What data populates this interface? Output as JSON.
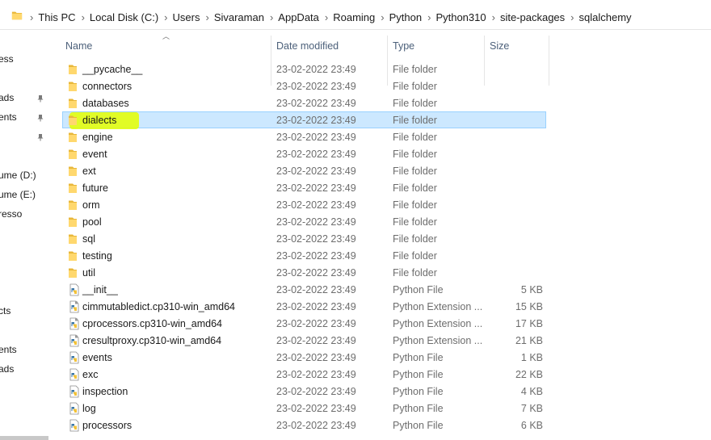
{
  "address": {
    "crumbs": [
      "This PC",
      "Local Disk (C:)",
      "Users",
      "Sivaraman",
      "AppData",
      "Roaming",
      "Python",
      "Python310",
      "site-packages",
      "sqlalchemy"
    ]
  },
  "nav": {
    "items": [
      {
        "label": "ess",
        "pinned": false
      },
      {
        "label": "ads",
        "pinned": true
      },
      {
        "label": "ents",
        "pinned": true
      },
      {
        "label": "",
        "pinned": true
      },
      {
        "label": "ume (D:)",
        "pinned": false
      },
      {
        "label": "ume (E:)",
        "pinned": false
      },
      {
        "label": "resso",
        "pinned": false
      },
      {
        "label": "cts",
        "pinned": false
      },
      {
        "label": "ents",
        "pinned": false
      },
      {
        "label": "ads",
        "pinned": false
      }
    ]
  },
  "columns": {
    "name": "Name",
    "date": "Date modified",
    "type": "Type",
    "size": "Size"
  },
  "files": [
    {
      "name": "__pycache__",
      "date": "23-02-2022 23:49",
      "type": "File folder",
      "size": "",
      "kind": "folder"
    },
    {
      "name": "connectors",
      "date": "23-02-2022 23:49",
      "type": "File folder",
      "size": "",
      "kind": "folder"
    },
    {
      "name": "databases",
      "date": "23-02-2022 23:49",
      "type": "File folder",
      "size": "",
      "kind": "folder"
    },
    {
      "name": "dialects",
      "date": "23-02-2022 23:49",
      "type": "File folder",
      "size": "",
      "kind": "folder",
      "selected": true
    },
    {
      "name": "engine",
      "date": "23-02-2022 23:49",
      "type": "File folder",
      "size": "",
      "kind": "folder"
    },
    {
      "name": "event",
      "date": "23-02-2022 23:49",
      "type": "File folder",
      "size": "",
      "kind": "folder"
    },
    {
      "name": "ext",
      "date": "23-02-2022 23:49",
      "type": "File folder",
      "size": "",
      "kind": "folder"
    },
    {
      "name": "future",
      "date": "23-02-2022 23:49",
      "type": "File folder",
      "size": "",
      "kind": "folder"
    },
    {
      "name": "orm",
      "date": "23-02-2022 23:49",
      "type": "File folder",
      "size": "",
      "kind": "folder"
    },
    {
      "name": "pool",
      "date": "23-02-2022 23:49",
      "type": "File folder",
      "size": "",
      "kind": "folder"
    },
    {
      "name": "sql",
      "date": "23-02-2022 23:49",
      "type": "File folder",
      "size": "",
      "kind": "folder"
    },
    {
      "name": "testing",
      "date": "23-02-2022 23:49",
      "type": "File folder",
      "size": "",
      "kind": "folder"
    },
    {
      "name": "util",
      "date": "23-02-2022 23:49",
      "type": "File folder",
      "size": "",
      "kind": "folder"
    },
    {
      "name": "__init__",
      "date": "23-02-2022 23:49",
      "type": "Python File",
      "size": "5 KB",
      "kind": "python"
    },
    {
      "name": "cimmutabledict.cp310-win_amd64",
      "date": "23-02-2022 23:49",
      "type": "Python Extension ...",
      "size": "15 KB",
      "kind": "pyext"
    },
    {
      "name": "cprocessors.cp310-win_amd64",
      "date": "23-02-2022 23:49",
      "type": "Python Extension ...",
      "size": "17 KB",
      "kind": "pyext"
    },
    {
      "name": "cresultproxy.cp310-win_amd64",
      "date": "23-02-2022 23:49",
      "type": "Python Extension ...",
      "size": "21 KB",
      "kind": "pyext"
    },
    {
      "name": "events",
      "date": "23-02-2022 23:49",
      "type": "Python File",
      "size": "1 KB",
      "kind": "python"
    },
    {
      "name": "exc",
      "date": "23-02-2022 23:49",
      "type": "Python File",
      "size": "22 KB",
      "kind": "python"
    },
    {
      "name": "inspection",
      "date": "23-02-2022 23:49",
      "type": "Python File",
      "size": "4 KB",
      "kind": "python"
    },
    {
      "name": "log",
      "date": "23-02-2022 23:49",
      "type": "Python File",
      "size": "7 KB",
      "kind": "python"
    },
    {
      "name": "processors",
      "date": "23-02-2022 23:49",
      "type": "Python File",
      "size": "6 KB",
      "kind": "python"
    }
  ],
  "colors": {
    "selection_bg": "#cce8ff",
    "selection_border": "#99d1ff",
    "highlight": "#e4ff00",
    "folder": "#ffd86e"
  }
}
